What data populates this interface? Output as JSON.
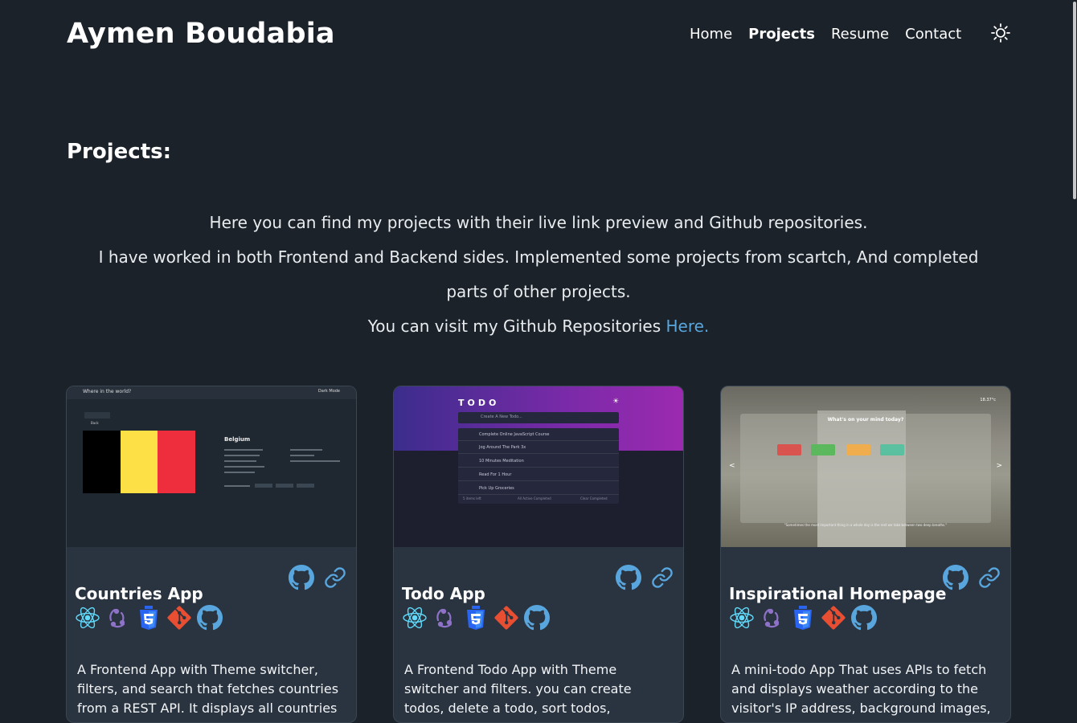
{
  "header": {
    "brand": "Aymen Boudabia",
    "nav": [
      {
        "label": "Home"
      },
      {
        "label": "Projects",
        "active": true
      },
      {
        "label": "Resume"
      },
      {
        "label": "Contact"
      }
    ],
    "theme_icon": "sun-icon"
  },
  "page": {
    "title": "Projects:",
    "intro_line1": "Here you can find my projects with their live link preview and Github repositories.",
    "intro_line2": "I have worked in both Frontend and Backend sides. Implemented some projects from scartch, And completed parts of other projects.",
    "intro_line3_prefix": "You can visit my Github Repositories ",
    "intro_link": "Here.",
    "link_color": "#58a6dd"
  },
  "cards": [
    {
      "title": "Countries App",
      "description": "A Frontend App with Theme switcher, filters, and search that fetches countries from a REST API. It displays all countries in Cards",
      "tech_icons": [
        "react-icon",
        "redux-icon",
        "css3-icon",
        "git-icon",
        "github-icon"
      ],
      "preview": {
        "header": "Where in the world?",
        "mode": "Dark Mode",
        "back": "Back",
        "country": "Belgium"
      }
    },
    {
      "title": "Todo App",
      "description": "A Frontend Todo App with Theme switcher and filters. you can create todos, delete a todo, sort todos, completed, filter todos by",
      "tech_icons": [
        "react-icon",
        "redux-icon",
        "css3-icon",
        "git-icon",
        "github-icon"
      ],
      "preview": {
        "logo": "TODO",
        "placeholder": "Create A New Todo...",
        "items": [
          "Complete Online JavaScript Course",
          "Jog Around The Park 3x",
          "10 Minutes Meditation",
          "Read For 1 Hour",
          "Pick Up Groceries"
        ],
        "footer_left": "5 items left",
        "footer_mid": "All  Active  Completed",
        "footer_right": "Clear Completed"
      }
    },
    {
      "title": "Inspirational Homepage",
      "description": "A mini-todo App That uses APIs to fetch and displays weather according to the visitor's IP address, background images, quotes and todos",
      "tech_icons": [
        "react-icon",
        "redux-icon",
        "css3-icon",
        "git-icon",
        "github-icon"
      ],
      "preview": {
        "weather": "18.37°c",
        "question": "What's on your mind today?",
        "quote": "\"Sometimes the most important thing in a whole day is the rest we take between two deep breaths.\""
      }
    }
  ]
}
